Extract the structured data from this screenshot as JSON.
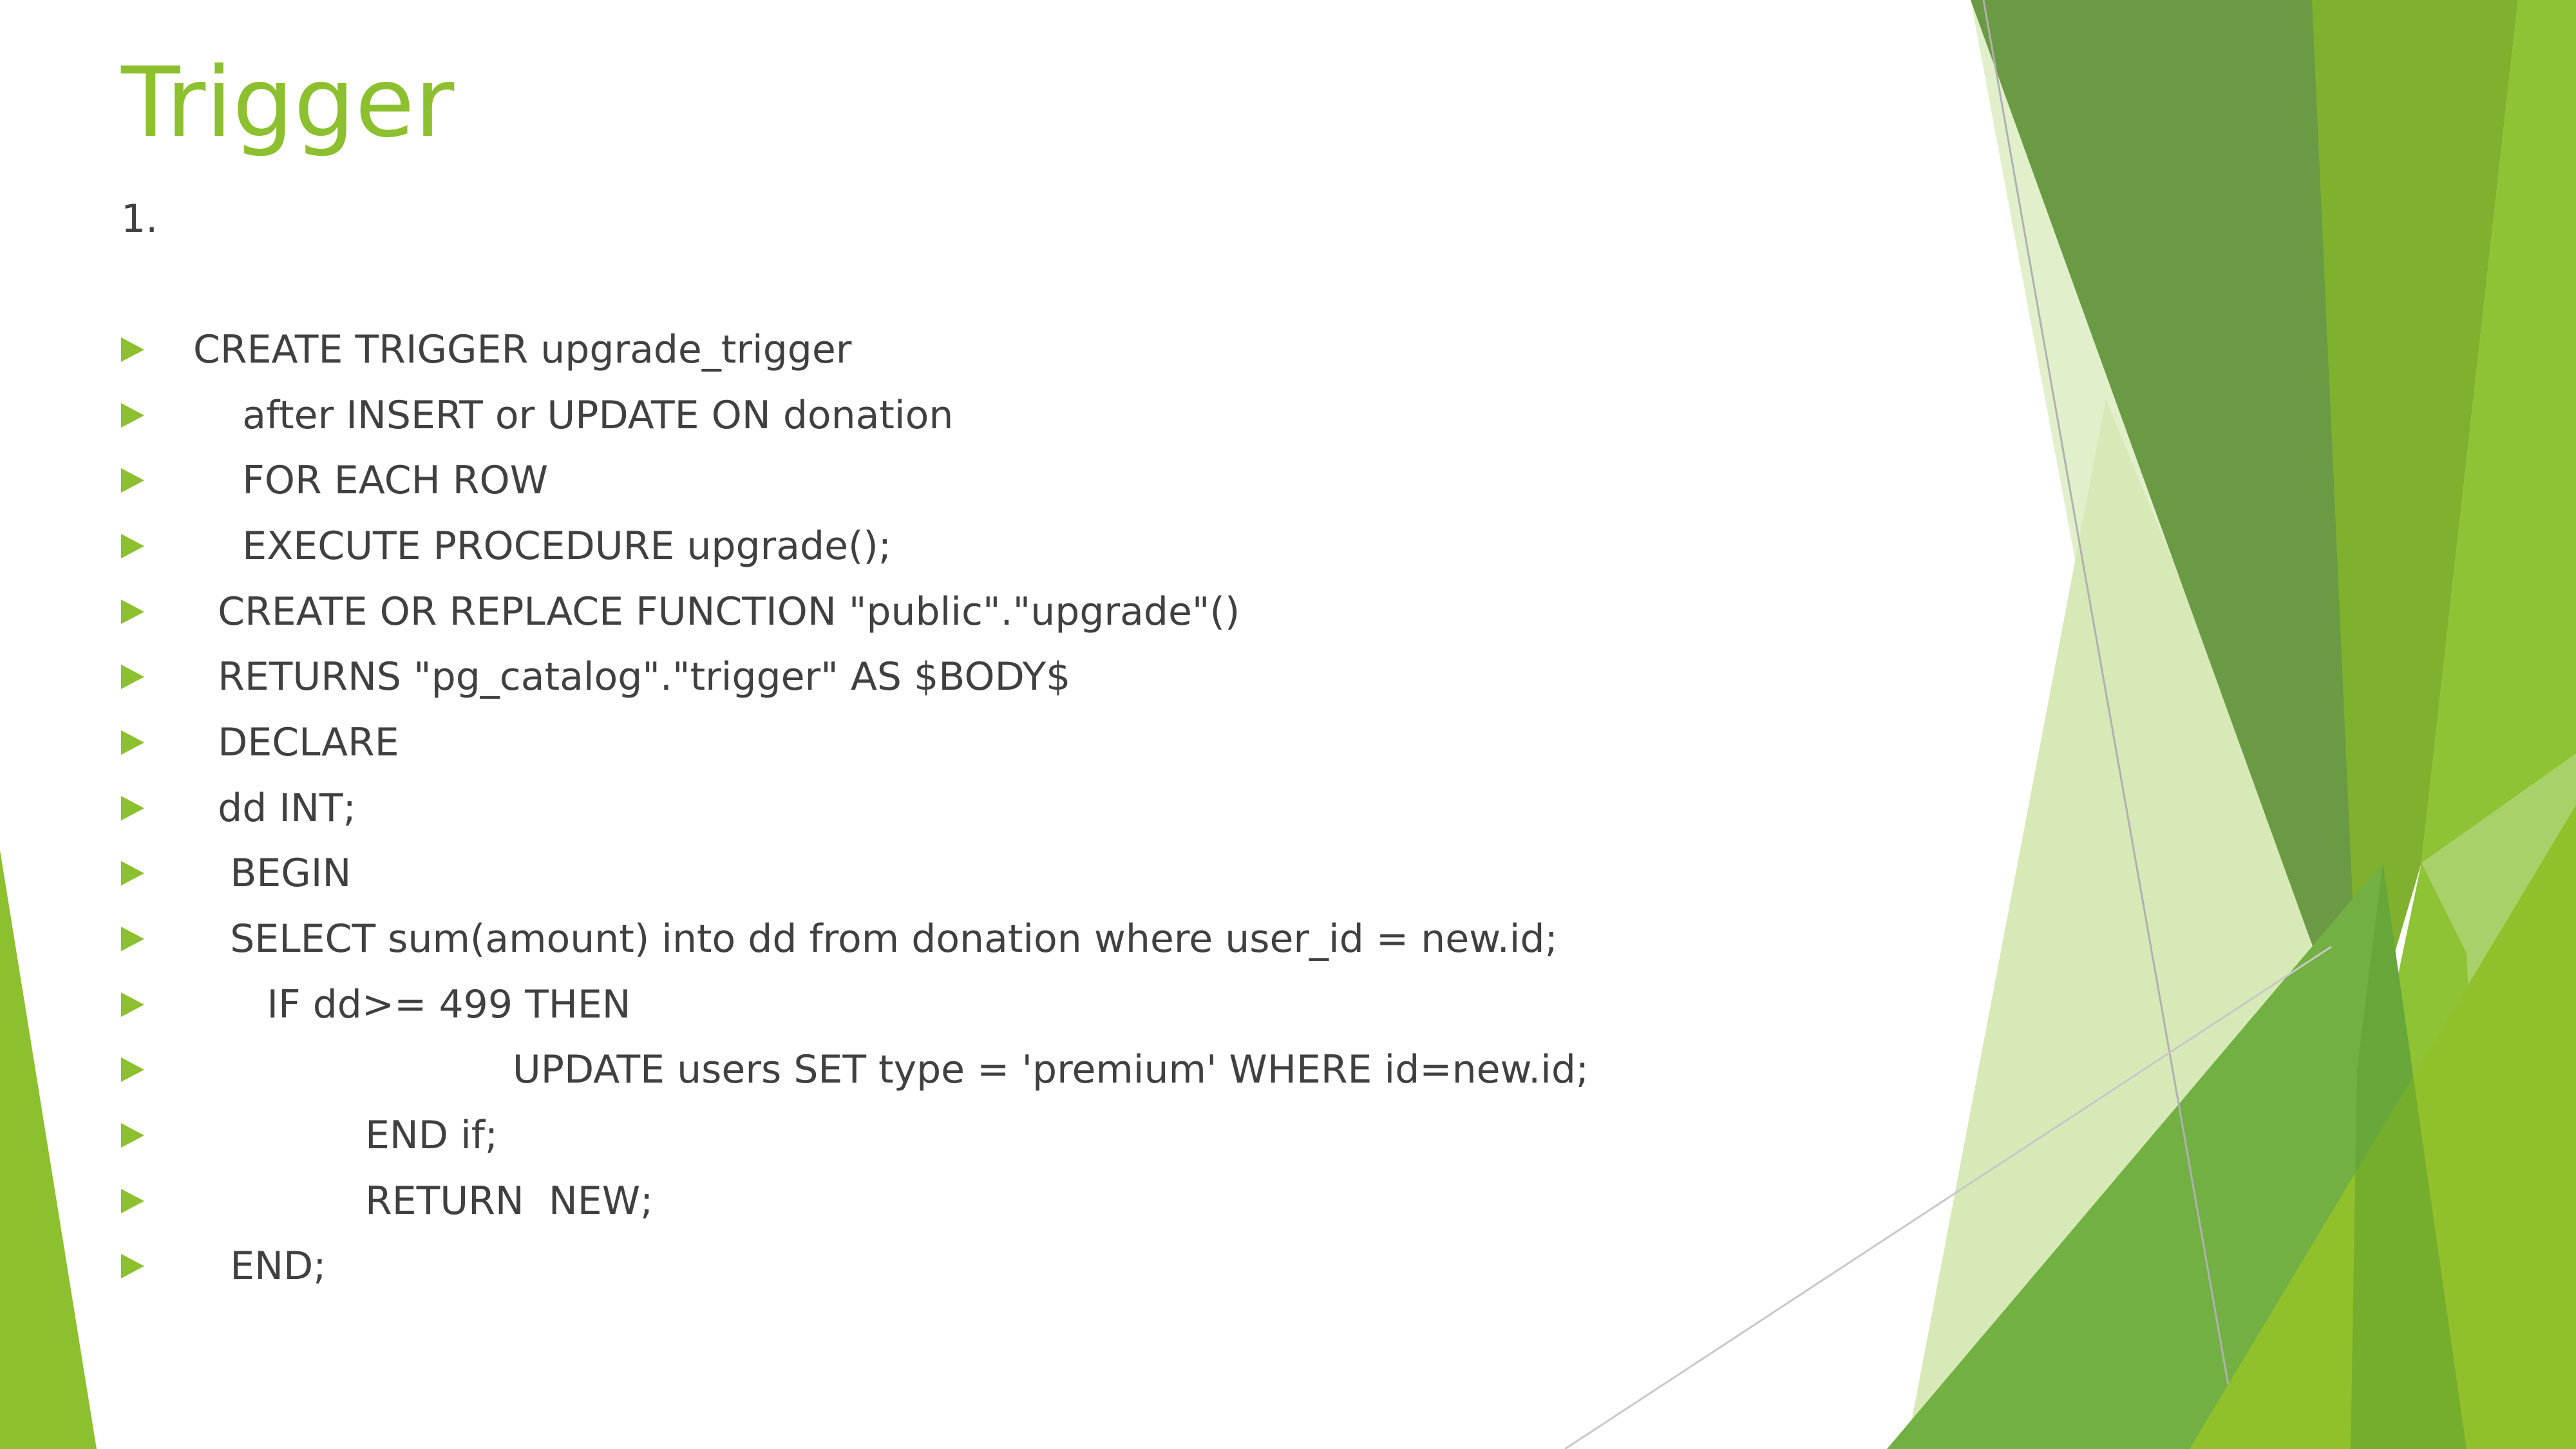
{
  "slide": {
    "title": "Trigger",
    "number": "1.",
    "code_lines": [
      "CREATE TRIGGER upgrade_trigger",
      "    after INSERT or UPDATE ON donation",
      "    FOR EACH ROW",
      "    EXECUTE PROCEDURE upgrade();",
      "  CREATE OR REPLACE FUNCTION \"public\".\"upgrade\"()",
      "  RETURNS \"pg_catalog\".\"trigger\" AS $BODY$",
      "  DECLARE",
      "  dd INT;",
      "   BEGIN",
      "   SELECT sum(amount) into dd from donation where user_id = new.id;",
      "      IF dd>= 499 THEN",
      "                          UPDATE users SET type = 'premium' WHERE id=new.id;",
      "              END if;",
      "              RETURN  NEW;",
      "   END;"
    ]
  },
  "colors": {
    "accent": "#8dc02e",
    "text": "#404040",
    "background": "#ffffff"
  }
}
